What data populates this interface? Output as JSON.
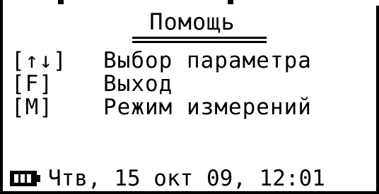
{
  "title": "Помощь",
  "items": [
    {
      "key": "[↑↓]",
      "label": "Выбор параметра"
    },
    {
      "key": "[F]",
      "label": "Выход"
    },
    {
      "key": "[M]",
      "label": "Режим измерений"
    }
  ],
  "status": {
    "battery_icon": "battery-full-icon",
    "datetime": "Чтв, 15 окт 09, 12:01"
  }
}
